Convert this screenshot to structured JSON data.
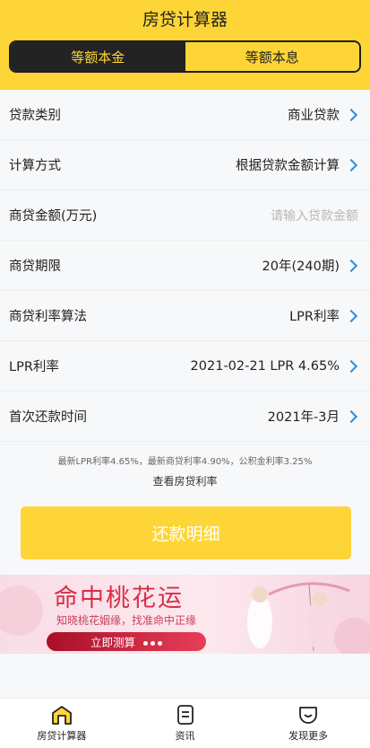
{
  "header": {
    "title": "房贷计算器",
    "tabs": [
      {
        "label": "等额本金",
        "active": true
      },
      {
        "label": "等额本息",
        "active": false
      }
    ]
  },
  "form": {
    "rows": [
      {
        "label": "贷款类别",
        "value": "商业贷款"
      },
      {
        "label": "计算方式",
        "value": "根据贷款金额计算"
      },
      {
        "label": "商贷金额(万元)",
        "placeholder": "请输入贷款金额"
      },
      {
        "label": "商贷期限",
        "value": "20年(240期)"
      },
      {
        "label": "商贷利率算法",
        "value": "LPR利率"
      },
      {
        "label": "LPR利率",
        "value": "2021-02-21 LPR 4.65%"
      },
      {
        "label": "首次还款时间",
        "value": "2021年-3月"
      }
    ]
  },
  "rates_note": "最新LPR利率4.65%，最新商贷利率4.90%，公积金利率3.25%",
  "rates_link": "查看房贷利率",
  "primary_button": "还款明细",
  "banner": {
    "title": "命中桃花运",
    "subtitle": "知晓桃花姻缘，找准命中正缘",
    "button": "立即测算"
  },
  "tabbar": [
    {
      "label": "房贷计算器",
      "icon": "house-icon"
    },
    {
      "label": "资讯",
      "icon": "document-icon"
    },
    {
      "label": "发现更多",
      "icon": "discover-icon"
    }
  ],
  "colors": {
    "accent": "#fdd536",
    "dark": "#232323",
    "link": "#2d8ce0"
  }
}
